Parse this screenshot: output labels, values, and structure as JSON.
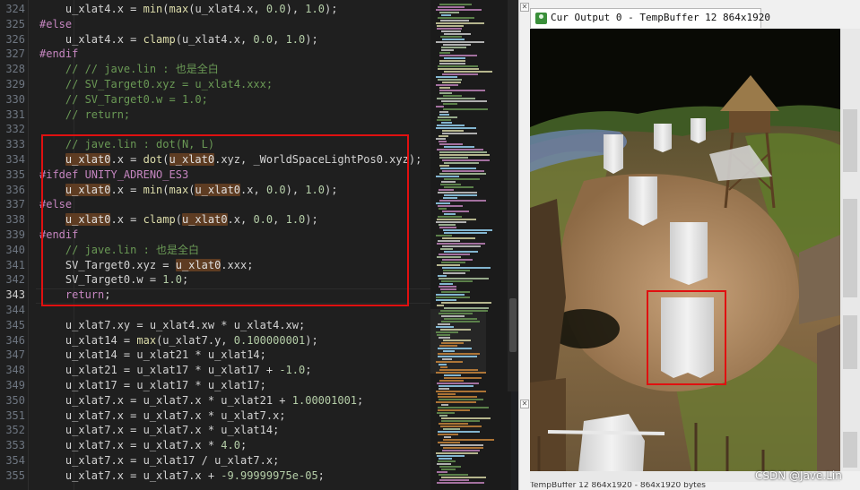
{
  "editor": {
    "line_numbers": [
      "324",
      "325",
      "326",
      "327",
      "328",
      "329",
      "330",
      "331",
      "332",
      "333",
      "334",
      "335",
      "336",
      "337",
      "338",
      "339",
      "340",
      "341",
      "342",
      "343",
      "344",
      "345",
      "346",
      "347",
      "348",
      "349",
      "350",
      "351",
      "352",
      "353",
      "354",
      "355"
    ],
    "active_line": "343"
  },
  "viewer": {
    "tab_title": "Cur Output 0 - TempBuffer 12 864x1920",
    "status_text": "TempBuffer 12 864x1920 - 864x1920 bytes",
    "watermark": "CSDN @Jave.Lin"
  },
  "colors": {
    "annotation": "#e01010",
    "keyword": "#c586c0",
    "comment": "#6a9955",
    "function": "#dcdcaa",
    "number": "#b5cea8",
    "highlight": "#5e3c22"
  },
  "code": [
    [
      [
        "    ",
        "plain"
      ],
      [
        "u_xlat4",
        "plain"
      ],
      [
        ".x = ",
        "plain"
      ],
      [
        "min",
        "fn"
      ],
      [
        "(",
        "plain"
      ],
      [
        "max",
        "fn"
      ],
      [
        "(u_xlat4.x, ",
        "plain"
      ],
      [
        "0.0",
        "nm"
      ],
      [
        "), ",
        "plain"
      ],
      [
        "1.0",
        "nm"
      ],
      [
        ");",
        "plain"
      ]
    ],
    [
      [
        "#else",
        "kw"
      ]
    ],
    [
      [
        "    u_xlat4.x = ",
        "plain"
      ],
      [
        "clamp",
        "fn"
      ],
      [
        "(u_xlat4.x, ",
        "plain"
      ],
      [
        "0.0",
        "nm"
      ],
      [
        ", ",
        "plain"
      ],
      [
        "1.0",
        "nm"
      ],
      [
        ");",
        "plain"
      ]
    ],
    [
      [
        "#endif",
        "kw"
      ]
    ],
    [
      [
        "    ",
        "plain"
      ],
      [
        "// // jave.lin : 也是全白",
        "cm"
      ]
    ],
    [
      [
        "    ",
        "plain"
      ],
      [
        "// SV_Target0.xyz = u_xlat4.xxx;",
        "cm"
      ]
    ],
    [
      [
        "    ",
        "plain"
      ],
      [
        "// SV_Target0.w = 1.0;",
        "cm"
      ]
    ],
    [
      [
        "    ",
        "plain"
      ],
      [
        "// return;",
        "cm"
      ]
    ],
    [],
    [
      [
        "    ",
        "plain"
      ],
      [
        "// jave.lin : dot(N, L)",
        "cm"
      ]
    ],
    [
      [
        "    ",
        "plain"
      ],
      [
        "u_xlat0",
        "hl"
      ],
      [
        ".x = ",
        "plain"
      ],
      [
        "dot",
        "fn"
      ],
      [
        "(",
        "plain"
      ],
      [
        "u_xlat0",
        "hl"
      ],
      [
        ".xyz, _WorldSpaceLightPos0.xyz);",
        "plain"
      ]
    ],
    [
      [
        "#ifdef UNITY_ADRENO_ES3",
        "kw"
      ]
    ],
    [
      [
        "    ",
        "plain"
      ],
      [
        "u_xlat0",
        "hl"
      ],
      [
        ".x = ",
        "plain"
      ],
      [
        "min",
        "fn"
      ],
      [
        "(",
        "plain"
      ],
      [
        "max",
        "fn"
      ],
      [
        "(",
        "plain"
      ],
      [
        "u_xlat0",
        "hl"
      ],
      [
        ".x, ",
        "plain"
      ],
      [
        "0.0",
        "nm"
      ],
      [
        "), ",
        "plain"
      ],
      [
        "1.0",
        "nm"
      ],
      [
        ");",
        "plain"
      ]
    ],
    [
      [
        "#else",
        "kw"
      ]
    ],
    [
      [
        "    ",
        "plain"
      ],
      [
        "u_xlat0",
        "hl"
      ],
      [
        ".x = ",
        "plain"
      ],
      [
        "clamp",
        "fn"
      ],
      [
        "(",
        "plain"
      ],
      [
        "u_xlat0",
        "hl"
      ],
      [
        ".x, ",
        "plain"
      ],
      [
        "0.0",
        "nm"
      ],
      [
        ", ",
        "plain"
      ],
      [
        "1.0",
        "nm"
      ],
      [
        ");",
        "plain"
      ]
    ],
    [
      [
        "#endif",
        "kw"
      ]
    ],
    [
      [
        "    ",
        "plain"
      ],
      [
        "// jave.lin : 也是全白",
        "cm"
      ]
    ],
    [
      [
        "    SV_Target0.xyz = ",
        "plain"
      ],
      [
        "u_xlat0",
        "hl"
      ],
      [
        ".xxx;",
        "plain"
      ]
    ],
    [
      [
        "    SV_Target0.w = ",
        "plain"
      ],
      [
        "1.0",
        "nm"
      ],
      [
        ";",
        "plain"
      ]
    ],
    [
      [
        "    ",
        "plain"
      ],
      [
        "return",
        "kw"
      ],
      [
        ";",
        "plain"
      ]
    ],
    [],
    [
      [
        "    u_xlat7.xy = u_xlat4.xw * u_xlat4.xw;",
        "plain"
      ]
    ],
    [
      [
        "    u_xlat14 = ",
        "plain"
      ],
      [
        "max",
        "fn"
      ],
      [
        "(u_xlat7.y, ",
        "plain"
      ],
      [
        "0.100000001",
        "nm"
      ],
      [
        ");",
        "plain"
      ]
    ],
    [
      [
        "    u_xlat14 = u_xlat21 * u_xlat14;",
        "plain"
      ]
    ],
    [
      [
        "    u_xlat21 = u_xlat17 * u_xlat17 + ",
        "plain"
      ],
      [
        "-1.0",
        "nm"
      ],
      [
        ";",
        "plain"
      ]
    ],
    [
      [
        "    u_xlat17 = u_xlat17 * u_xlat17;",
        "plain"
      ]
    ],
    [
      [
        "    u_xlat7.x = u_xlat7.x * u_xlat21 + ",
        "plain"
      ],
      [
        "1.00001001",
        "nm"
      ],
      [
        ";",
        "plain"
      ]
    ],
    [
      [
        "    u_xlat7.x = u_xlat7.x * u_xlat7.x;",
        "plain"
      ]
    ],
    [
      [
        "    u_xlat7.x = u_xlat7.x * u_xlat14;",
        "plain"
      ]
    ],
    [
      [
        "    u_xlat7.x = u_xlat7.x * ",
        "plain"
      ],
      [
        "4.0",
        "nm"
      ],
      [
        ";",
        "plain"
      ]
    ],
    [
      [
        "    u_xlat7.x = u_xlat17 / u_xlat7.x;",
        "plain"
      ]
    ],
    [
      [
        "    u_xlat7.x = u_xlat7.x + ",
        "plain"
      ],
      [
        "-9.99999975e-05",
        "nm"
      ],
      [
        ";",
        "plain"
      ]
    ]
  ]
}
